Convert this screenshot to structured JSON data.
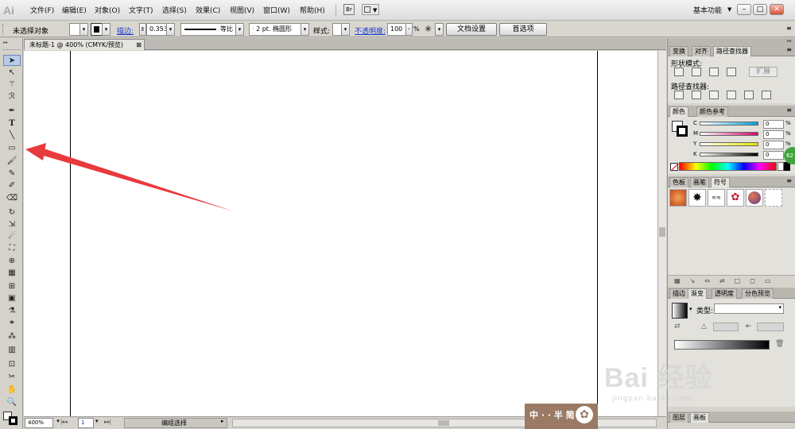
{
  "app": {
    "logo": "Ai"
  },
  "menu": [
    "文件(F)",
    "编辑(E)",
    "对象(O)",
    "文字(T)",
    "选择(S)",
    "效果(C)",
    "视图(V)",
    "窗口(W)",
    "帮助(H)"
  ],
  "menu_icons": {
    "bridge": "Br"
  },
  "workspace": {
    "label": "基本功能",
    "arrow": "▼"
  },
  "window_buttons": {
    "minimize": "–",
    "restore": "□",
    "close": "✕"
  },
  "control": {
    "selection_status": "未选择对象",
    "stroke_label": "描边:",
    "stroke_weight": "0.353",
    "stroke_profile": "等比",
    "brush": "2 pt. 椭圆形",
    "style_label": "样式:",
    "opacity_label": "不透明度:",
    "opacity_value": "100",
    "opacity_unit": "%",
    "doc_setup": "文档设置",
    "preferences": "首选项"
  },
  "document": {
    "tab_title": "未标题-1 @ 400% (CMYK/预览)",
    "close": "⊠"
  },
  "statusbar": {
    "zoom": "400%",
    "page": "1",
    "status": "编组选择"
  },
  "pathfinder_panel": {
    "tabs": [
      "变换",
      "对齐",
      "路径查找器"
    ],
    "active_tab": "路径查找器",
    "shape_modes_label": "形状模式:",
    "expand_button": "扩展",
    "pathfinders_label": "路径查找器:"
  },
  "color_panel": {
    "tabs": [
      "颜色",
      "颜色参考"
    ],
    "active_tab": "颜色",
    "channels": [
      {
        "name": "C",
        "value": "0",
        "unit": "%",
        "color": "#00a3d9"
      },
      {
        "name": "M",
        "value": "0",
        "unit": "%",
        "color": "#d9006f"
      },
      {
        "name": "Y",
        "value": "0",
        "unit": "%",
        "color": "#e6e600"
      },
      {
        "name": "K",
        "value": "0",
        "unit": "%",
        "color": "#000000"
      }
    ]
  },
  "symbols_panel": {
    "tabs": [
      "色板",
      "画笔",
      "符号"
    ],
    "active_tab": "符号",
    "symbols": [
      {
        "name": "cube-symbol",
        "color": "#d45a1c"
      },
      {
        "name": "splat-symbol",
        "color": "#111111"
      },
      {
        "name": "grunge-symbol",
        "color": "#333333"
      },
      {
        "name": "ribbon-symbol",
        "color": "#c5182a"
      },
      {
        "name": "sphere-symbol",
        "color": "#7a4a9e"
      },
      {
        "name": "frame-symbol",
        "color": "#ffffff"
      }
    ]
  },
  "gradient_panel": {
    "tabs": [
      "描边",
      "渐变",
      "透明度",
      "分色预览"
    ],
    "active_tab": "渐变",
    "type_label": "类型:"
  },
  "layers_panel": {
    "tabs": [
      "图层",
      "画板"
    ],
    "active_tab": "画板"
  },
  "watermark": {
    "brand": "中 · · 半 简",
    "baidu": "Bai   经验",
    "baidu_url": "jingyan.baidu.com",
    "badge": "62"
  },
  "colors": {
    "arrow": "#e8393c",
    "accent_link": "#1a38c8"
  }
}
